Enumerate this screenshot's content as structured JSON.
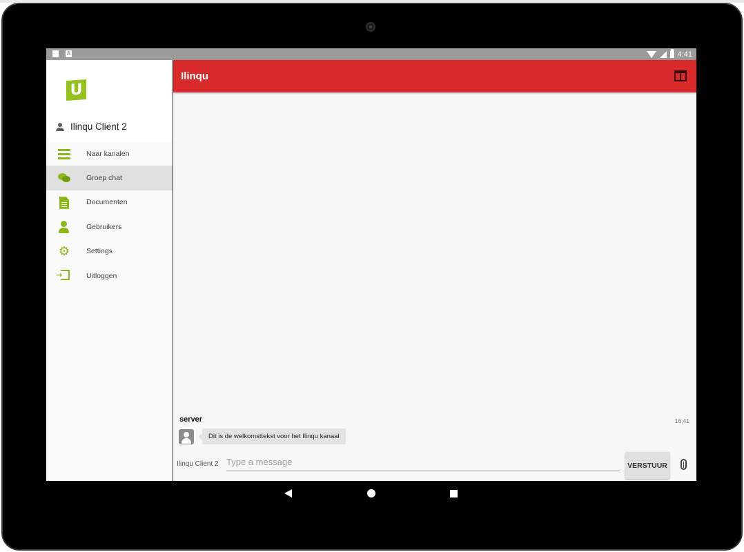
{
  "status_bar": {
    "time": "4:41",
    "icons": [
      "sd-card-icon",
      "a-icon",
      "wifi-icon",
      "signal-icon",
      "battery-icon"
    ]
  },
  "drawer": {
    "logo_letter": "U",
    "user_name": "Ilinqu Client 2",
    "items": [
      {
        "label": "Naar kanalen",
        "icon": "menu-icon",
        "active": false
      },
      {
        "label": "Groep chat",
        "icon": "chat-icon",
        "active": true
      },
      {
        "label": "Documenten",
        "icon": "document-icon",
        "active": false
      },
      {
        "label": "Gebruikers",
        "icon": "user-icon",
        "active": false
      },
      {
        "label": "Settings",
        "icon": "gear-icon",
        "active": false
      },
      {
        "label": "Uitloggen",
        "icon": "logout-icon",
        "active": false
      }
    ]
  },
  "app_bar": {
    "title": "Ilinqu",
    "action_icon": "split-view-icon"
  },
  "messages": [
    {
      "sender": "server",
      "time": "16:41",
      "text": "Dit is de welkomsttekst voor het Ilinqu kanaal"
    }
  ],
  "composer": {
    "user_label": "Ilinqu Client 2",
    "placeholder": "Type a message",
    "value": "",
    "send_label": "VERSTUUR",
    "attach_icon": "paperclip-icon"
  },
  "colors": {
    "app_bar": "#d82a2a",
    "accent": "#8cb81f",
    "logo": "#95c11f"
  }
}
